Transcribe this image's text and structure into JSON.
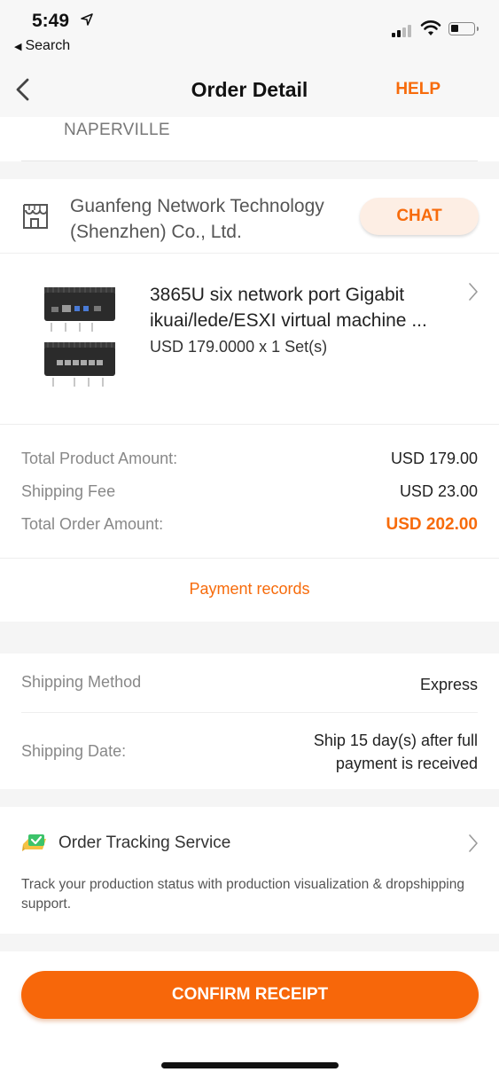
{
  "status_bar": {
    "time": "5:49",
    "back_app": "Search"
  },
  "nav": {
    "title": "Order Detail",
    "help_label": "HELP"
  },
  "address": {
    "city": "NAPERVILLE"
  },
  "seller": {
    "name": "Guanfeng Network Technology (Shenzhen) Co., Ltd.",
    "chat_label": "CHAT"
  },
  "product": {
    "title": "3865U six network port Gigabit ikuai/lede/ESXI virtual machine ...",
    "price_qty": "USD 179.0000 x 1 Set(s)"
  },
  "amounts": {
    "product_label": "Total Product Amount:",
    "product_value": "USD 179.00",
    "shipping_label": "Shipping Fee",
    "shipping_value": "USD 23.00",
    "order_label": "Total Order Amount:",
    "order_value": "USD 202.00"
  },
  "payment": {
    "link_label": "Payment records"
  },
  "shipping": {
    "method_label": "Shipping Method",
    "method_value": "Express",
    "date_label": "Shipping Date:",
    "date_value": "Ship 15 day(s) after full payment is received"
  },
  "tracking": {
    "title": "Order Tracking Service",
    "description": "Track your production status with production visualization & dropshipping support."
  },
  "footer": {
    "confirm_label": "CONFIRM RECEIPT"
  },
  "colors": {
    "accent": "#f76b0b",
    "chat_bg": "#fdeee4",
    "tracking_icon_green": "#3cc36a",
    "tracking_icon_yellow": "#f5c242"
  },
  "icons": [
    "location-arrow-icon",
    "signal-icon",
    "wifi-icon",
    "battery-icon",
    "back-chevron-icon",
    "store-icon",
    "product-chevron-icon",
    "tracking-check-icon",
    "tracking-chevron-icon"
  ]
}
